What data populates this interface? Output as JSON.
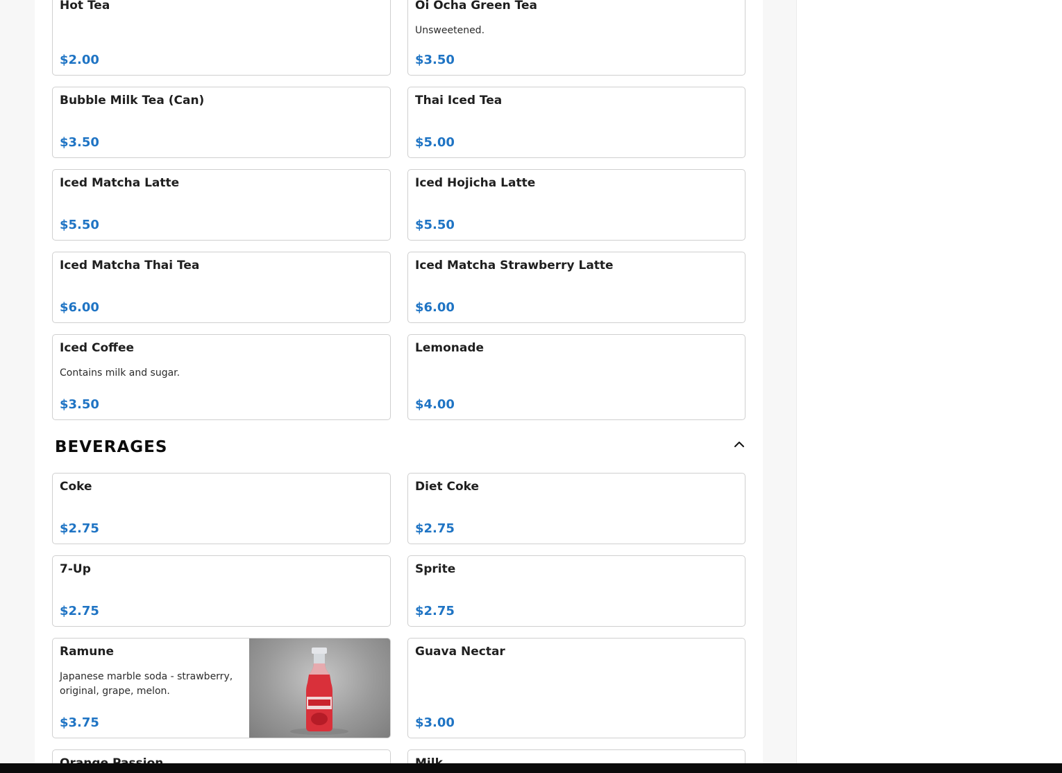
{
  "tea_section": {
    "items": [
      {
        "name": "Hot Tea",
        "desc": "",
        "price": "$2.00"
      },
      {
        "name": "Oi Ocha Green Tea",
        "desc": "Unsweetened.",
        "price": "$3.50"
      },
      {
        "name": "Bubble Milk Tea (Can)",
        "desc": "",
        "price": "$3.50"
      },
      {
        "name": "Thai Iced Tea",
        "desc": "",
        "price": "$5.00"
      },
      {
        "name": "Iced Matcha Latte",
        "desc": "",
        "price": "$5.50"
      },
      {
        "name": "Iced Hojicha Latte",
        "desc": "",
        "price": "$5.50"
      },
      {
        "name": "Iced Matcha Thai Tea",
        "desc": "",
        "price": "$6.00"
      },
      {
        "name": "Iced Matcha Strawberry Latte",
        "desc": "",
        "price": "$6.00"
      },
      {
        "name": "Iced Coffee",
        "desc": "Contains milk and sugar.",
        "price": "$3.50"
      },
      {
        "name": "Lemonade",
        "desc": "",
        "price": "$4.00"
      }
    ]
  },
  "beverages": {
    "title": "BEVERAGES",
    "toggle_icon": "chevron-up-icon",
    "items": [
      {
        "name": "Coke",
        "desc": "",
        "price": "$2.75"
      },
      {
        "name": "Diet Coke",
        "desc": "",
        "price": "$2.75"
      },
      {
        "name": "7-Up",
        "desc": "",
        "price": "$2.75"
      },
      {
        "name": "Sprite",
        "desc": "",
        "price": "$2.75"
      },
      {
        "name": "Ramune",
        "desc": "Japanese marble soda - strawberry, original, grape, melon.",
        "price": "$3.75"
      },
      {
        "name": "Guava Nectar",
        "desc": "",
        "price": "$3.00"
      },
      {
        "name": "Orange Passion",
        "desc": "",
        "price": ""
      },
      {
        "name": "Milk",
        "desc": "",
        "price": ""
      }
    ]
  },
  "colors": {
    "price": "#1f74c4",
    "card_border": "#cfcfcf",
    "page_background": "#f7f7f7",
    "bottom_bar": "#0b0b0b"
  }
}
